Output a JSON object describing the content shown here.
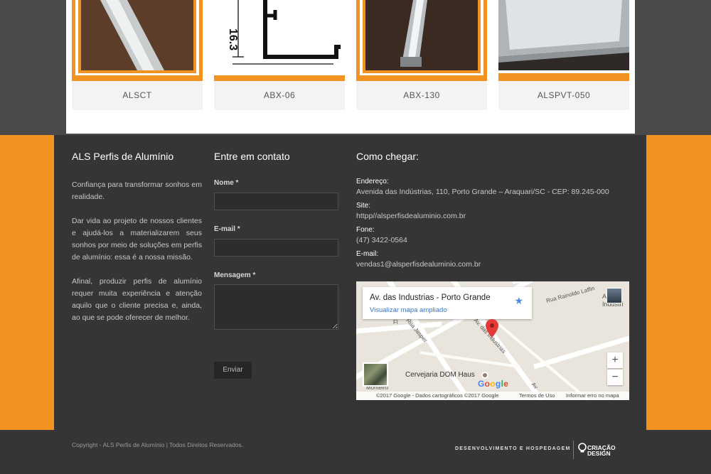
{
  "products": [
    {
      "code": "ALSCT",
      "image": "aluminium-flat-profile-photo"
    },
    {
      "code": "ABX-06",
      "image": "aluminium-profile-technical-drawing",
      "drawing_dimension": "16.3"
    },
    {
      "code": "ABX-130",
      "image": "aluminium-channel-profile-photo"
    },
    {
      "code": "ALSPVT-050",
      "image": "aluminium-angle-profile-photo"
    }
  ],
  "about": {
    "title": "ALS Perfis de Alumínio",
    "paragraphs": [
      "Confiança para transformar sonhos em realidade.",
      "Dar vida ao projeto de nossos clientes e ajudá-los a materializarem seus sonhos por meio de soluções em perfis de alumínio: essa é a nossa missão.",
      "Afinal, produzir perfis de alumínio requer muita experiência e atenção aquilo que o cliente precisa e, ainda, ao que se pode oferecer de melhor."
    ]
  },
  "contact_form": {
    "title": "Entre em contato",
    "name_label": "Nome *",
    "email_label": "E-mail *",
    "message_label": "Mensagem *",
    "submit_label": "Enviar"
  },
  "directions": {
    "title": "Como chegar:",
    "address_label": "Endereço:",
    "address_value": "Avenida das Indústrias, 110, Porto Grande – Araquari/SC - CEP: 89.245-000",
    "site_label": "Site:",
    "site_value": "httpp//alsperfisdealuminio.com.br",
    "phone_label": "Fone:",
    "phone_value": "(47) 3422-0564",
    "email_label": "E-mail:",
    "email_value": "vendas1@alsperfisdealuminio.com.br"
  },
  "map": {
    "place_title": "Av. das Industrias - Porto Grande",
    "larger_map_link": "Visualizar mapa ampliado",
    "poi_label": "Cervejaria DOM Haus",
    "street_1": "Rua Rainoldo Laffin",
    "street_2": "Av. das Industrias",
    "street_3": "Rua Jasper",
    "poi_partial": "Industri",
    "poi_partial_2": "Al",
    "street_partial_1": "Fl",
    "street_partial_2": "Av",
    "street_partial_3": "Monteiro",
    "zoom_in": "+",
    "zoom_out": "−",
    "google": [
      "G",
      "o",
      "o",
      "g",
      "l",
      "e"
    ],
    "google_colors": [
      "#4285f4",
      "#ea4335",
      "#fbbc05",
      "#4285f4",
      "#34a853",
      "#ea4335"
    ],
    "attribution": "©2017 Google - Dados cartográficos ©2017 Google",
    "terms": "Termos de Uso",
    "report": "Informar erro no mapa"
  },
  "footer": {
    "copyright": "Copyright - ALS Perfis de Alumínio | Todos Direitos Reservados.",
    "developer": "DESENVOLVIMENTO E HOSPEDAGEM",
    "brand_line1": "CRIAÇÃO",
    "brand_line2": "DESIGN"
  },
  "colors": {
    "accent_orange": "#f29220",
    "footer_dark": "#353535",
    "link_blue": "#3a74c9"
  }
}
